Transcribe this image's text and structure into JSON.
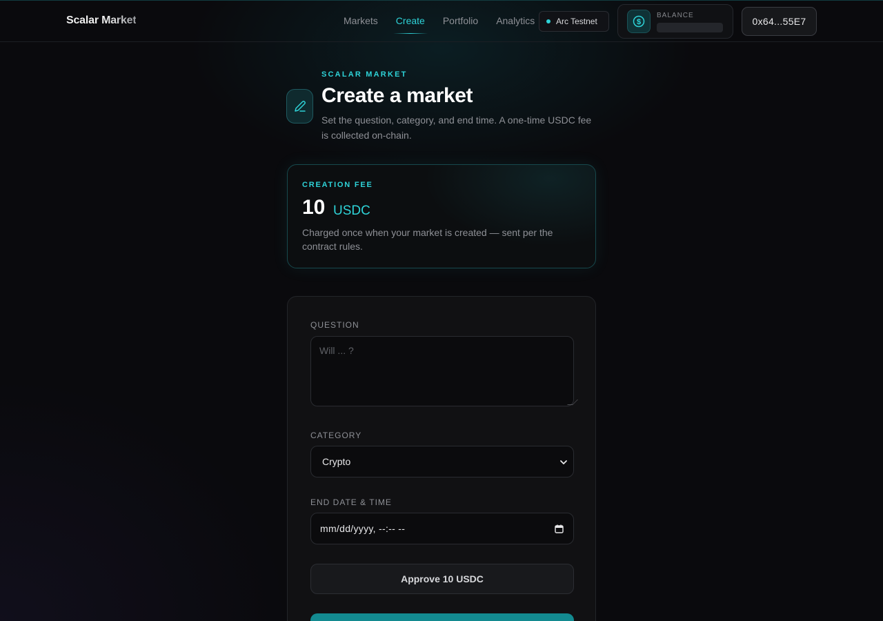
{
  "header": {
    "brand": "Scalar Market",
    "nav": [
      {
        "label": "Markets",
        "active": false
      },
      {
        "label": "Create",
        "active": true
      },
      {
        "label": "Portfolio",
        "active": false
      },
      {
        "label": "Analytics",
        "active": false
      }
    ],
    "network": "Arc Testnet",
    "balance_label": "BALANCE",
    "wallet": "0x64...55E7"
  },
  "hero": {
    "eyebrow": "SCALAR MARKET",
    "title": "Create a market",
    "subtitle": "Set the question, category, and end time. A one-time USDC fee is collected on-chain."
  },
  "fee": {
    "label": "CREATION FEE",
    "amount": "10",
    "unit": "USDC",
    "description": "Charged once when your market is created — sent per the contract rules."
  },
  "form": {
    "question_label": "QUESTION",
    "question_placeholder": "Will ... ?",
    "category_label": "CATEGORY",
    "category_value": "Crypto",
    "end_label": "END DATE & TIME",
    "end_placeholder": "mm/dd/yyyy, --:-- --",
    "approve_label": "Approve 10 USDC"
  },
  "colors": {
    "accent": "#2ed3d8",
    "background": "#0a0a0d",
    "primary_button": "#138a90"
  }
}
